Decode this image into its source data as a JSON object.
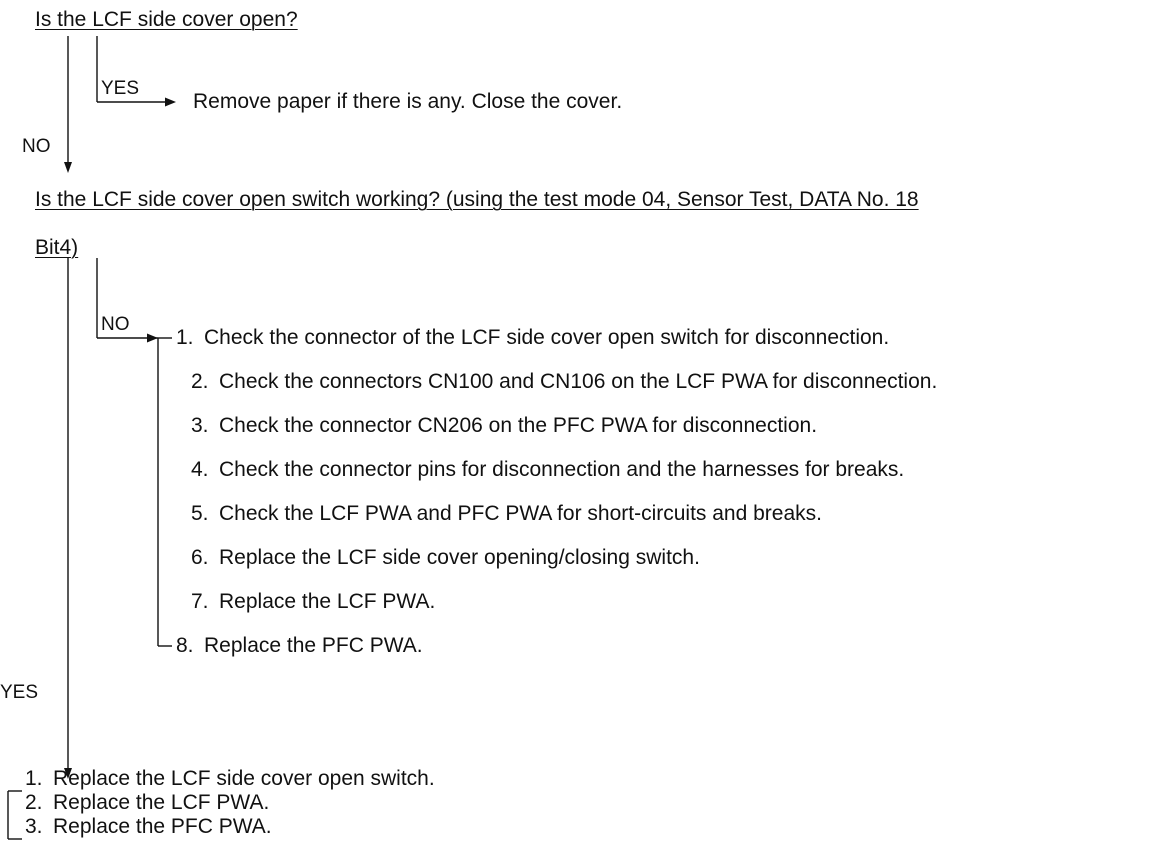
{
  "question1": "Is the LCF side cover open?",
  "yes1": {
    "label": "YES",
    "text": "Remove paper if there is any. Close the cover."
  },
  "no1": {
    "label": "NO"
  },
  "question2": {
    "line1": "Is the LCF side cover open switch working? (using the test mode 04, Sensor Test, DATA No. 18",
    "line2": "Bit4)"
  },
  "no2": {
    "label": "NO",
    "items": [
      {
        "num": "1.",
        "text": "Check the connector of the LCF side cover open switch for disconnection."
      },
      {
        "num": "2.",
        "text": "Check the connectors CN100 and CN106 on the LCF PWA for disconnection."
      },
      {
        "num": "3.",
        "text": "Check the connector CN206 on the PFC PWA for disconnection."
      },
      {
        "num": "4.",
        "text": "Check the connector pins for disconnection and the harnesses for breaks."
      },
      {
        "num": "5.",
        "text": "Check the LCF PWA and PFC PWA for short-circuits and breaks."
      },
      {
        "num": "6.",
        "text": "Replace the LCF side cover opening/closing switch."
      },
      {
        "num": "7.",
        "text": "Replace the LCF PWA."
      },
      {
        "num": "8.",
        "text": "Replace the PFC PWA."
      }
    ]
  },
  "yes2": {
    "label": "YES",
    "items": [
      {
        "num": "1.",
        "text": "Replace the LCF side cover open switch."
      },
      {
        "num": "2.",
        "text": "Replace the LCF PWA."
      },
      {
        "num": "3.",
        "text": "Replace the PFC PWA."
      }
    ]
  }
}
